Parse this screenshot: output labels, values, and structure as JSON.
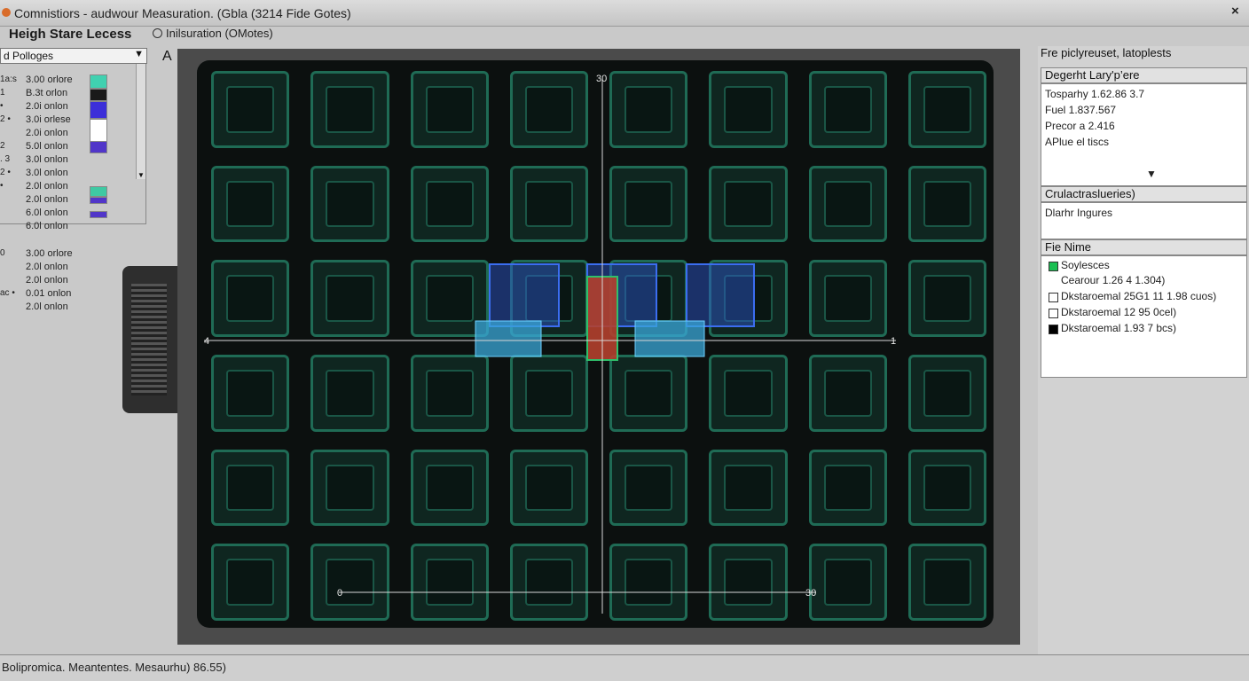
{
  "window": {
    "title": "Comnistiors - audwour Measuration. (Gbla (3214 Fide Gotes)",
    "close": "×"
  },
  "header": {
    "heading": "Heigh Stare Lecess",
    "option": "Inilsuration (OMotes)"
  },
  "leftpane": {
    "dropdown": "d Polloges",
    "arrow_a": "A",
    "legend": [
      {
        "prefix": "1a:s",
        "label": "3.00 orlore"
      },
      {
        "prefix": "1 ",
        "label": "B.3t orlon"
      },
      {
        "prefix": "•",
        "label": "2.0i onlon"
      },
      {
        "prefix": "2 •",
        "label": "3.0i orlese"
      },
      {
        "prefix": "",
        "label": "2.0i onlon"
      },
      {
        "prefix": "2",
        "label": "5.0l onlon"
      },
      {
        "prefix": ". 3",
        "label": "3.0l onlon"
      },
      {
        "prefix": "2 •",
        "label": "3.0l onlon"
      },
      {
        "prefix": "•",
        "label": "2.0l onlon"
      },
      {
        "prefix": "",
        "label": "2.0l onlon"
      },
      {
        "prefix": "",
        "label": "6.0l onlon"
      },
      {
        "prefix": "",
        "label": "6.0l onlon"
      },
      {
        "prefix": "0 ",
        "label": "3.00 orlore"
      },
      {
        "prefix": "",
        "label": "2.0l onlon"
      },
      {
        "prefix": "",
        "label": "2.0l onlon"
      },
      {
        "prefix": "ac •",
        "label": "0.01 onlon"
      },
      {
        "prefix": "",
        "label": "2.0l onlon"
      }
    ],
    "swatch_colors": [
      "#40d1b0",
      "#1a1a1a",
      "#3c2fd8",
      "#ffffff",
      "#5136c9",
      "#3fc9a3",
      "#5136c9",
      "#5136c9"
    ]
  },
  "canvas": {
    "top_label": "30",
    "mid_left_label": "4",
    "mid_right_label": "1",
    "bottom_left_label": "0",
    "bottom_right_label": "30",
    "colors": {
      "board": "#0c100f",
      "tile": "#1f6b55",
      "highlight_blue": "#2f5bd8",
      "bar_red": "#b3402e",
      "cyan_bar": "#3aa7d8"
    }
  },
  "rightpane": {
    "title": "Fre piclyreuset, latoplests",
    "box1_head": "Degerht Lary'p’ere",
    "box1_lines": [
      "Tosparhy 1.62.86 3.7",
      "Fuel 1.837.567",
      "Precor a 2.416",
      "APlue el tiscs"
    ],
    "box2_head": "Crulactraslueries)",
    "box2_lines": [
      "Dlarhr Ingures"
    ],
    "box3_head": "Fie Nime",
    "box3_items": [
      {
        "label": "Soylesces",
        "color": "#1bbf53"
      },
      {
        "label": "Cearour 1.26 4 1.304)",
        "color": ""
      },
      {
        "label": "Dkstaroemal 25G1 11 1.98 cuos)",
        "color": "#ffffff"
      },
      {
        "label": "Dkstaroemal 12 95 0cel)",
        "color": "#ffffff"
      },
      {
        "label": "Dkstaroemal 1.93 7 bcs)",
        "color": "#000000"
      }
    ]
  },
  "status": {
    "text": "Bolipromica. Meantentes. Mesaurhu) 86.55)"
  }
}
